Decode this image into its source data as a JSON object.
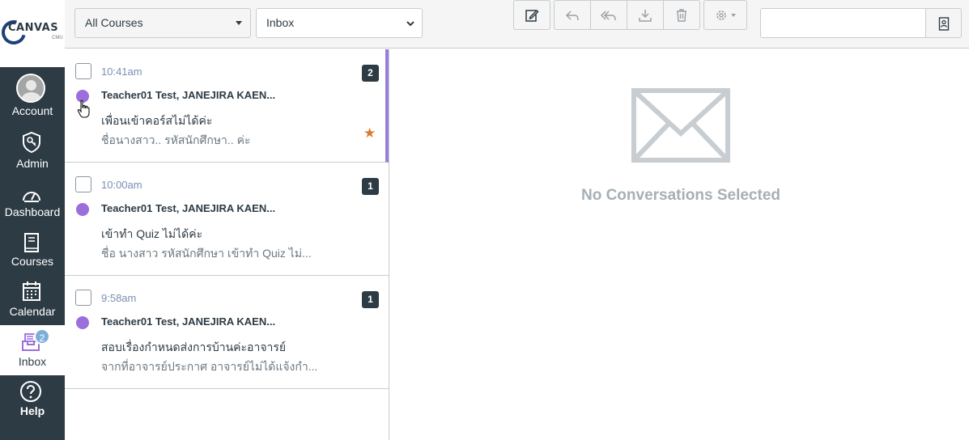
{
  "brand": {
    "logo_text": "CANVAS",
    "logo_sub": "CMU"
  },
  "nav": {
    "account": "Account",
    "admin": "Admin",
    "dashboard": "Dashboard",
    "courses": "Courses",
    "calendar": "Calendar",
    "inbox": "Inbox",
    "inbox_badge": "2",
    "help": "Help"
  },
  "toolbar": {
    "course_filter": "All Courses",
    "mailbox_filter": "Inbox",
    "search_value": ""
  },
  "conversations": [
    {
      "time": "10:41am",
      "count": "2",
      "participants": "Teacher01 Test, JANEJIRA KAEN...",
      "subject": "เพื่อนเข้าคอร์สไม่ได้ค่ะ",
      "preview": "ชื่อนางสาว.. รหัสนักศึกษา.. ค่ะ",
      "starred": true,
      "selected": true
    },
    {
      "time": "10:00am",
      "count": "1",
      "participants": "Teacher01 Test, JANEJIRA KAEN...",
      "subject": "เข้าทำ Quiz ไม่ได้ค่ะ",
      "preview": "ชื่อ นางสาว รหัสนักศึกษา เข้าทำ Quiz ไม่...",
      "starred": false,
      "selected": false
    },
    {
      "time": "9:58am",
      "count": "1",
      "participants": "Teacher01 Test, JANEJIRA KAEN...",
      "subject": "สอบเรื่องกำหนดส่งการบ้านค่ะอาจารย์",
      "preview": "จากที่อาจารย์ประกาศ อาจารย์ไม่ได้แจ้งกำ...",
      "starred": false,
      "selected": false
    }
  ],
  "message_area": {
    "empty_text": "No Conversations Selected"
  },
  "colors": {
    "nav_bg": "#2d3b45",
    "unread": "#9b6edb",
    "star": "#d97b2d",
    "time": "#7b8fb3"
  }
}
